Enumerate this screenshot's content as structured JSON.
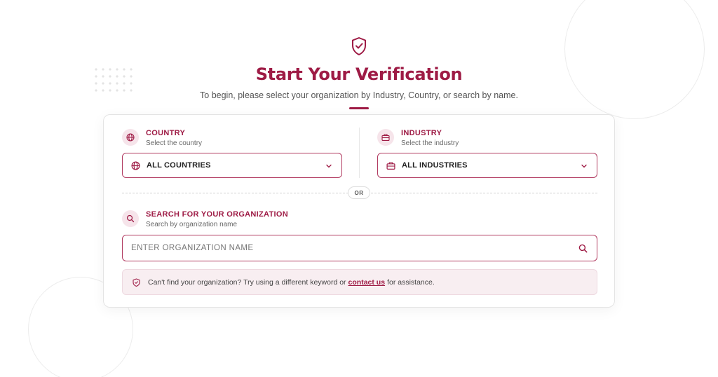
{
  "header": {
    "title": "Start Your Verification",
    "subtitle": "To begin, please select your organization by Industry, Country, or search by name."
  },
  "country": {
    "heading": "COUNTRY",
    "subheading": "Select the country",
    "selected": "ALL COUNTRIES"
  },
  "industry": {
    "heading": "INDUSTRY",
    "subheading": "Select the industry",
    "selected": "ALL INDUSTRIES"
  },
  "divider": {
    "label": "OR"
  },
  "search": {
    "heading": "SEARCH FOR YOUR ORGANIZATION",
    "subheading": "Search by organization name",
    "placeholder": "ENTER ORGANIZATION NAME"
  },
  "notice": {
    "text_before": "Can't find your organization? Try using a different keyword or",
    "link": "contact us",
    "text_after": "for assistance."
  },
  "colors": {
    "accent": "#9e1b45",
    "icon_bg": "#f6e4ea",
    "notice_bg": "#f8eef1"
  },
  "icons": {
    "header": "shield-check-icon",
    "country": "globe-icon",
    "industry": "briefcase-icon",
    "search": "search-icon",
    "dropdown": "chevron-down-icon",
    "notice": "shield-icon"
  }
}
